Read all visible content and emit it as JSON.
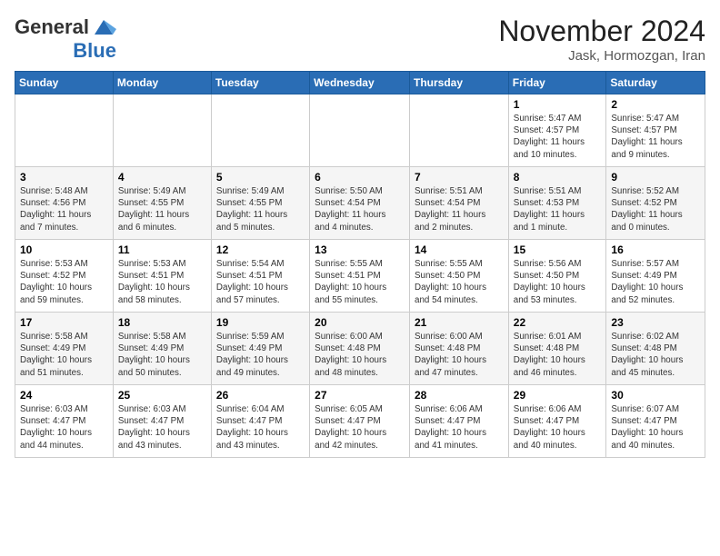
{
  "header": {
    "logo_line1": "General",
    "logo_line2": "Blue",
    "month_title": "November 2024",
    "subtitle": "Jask, Hormozgan, Iran"
  },
  "weekdays": [
    "Sunday",
    "Monday",
    "Tuesday",
    "Wednesday",
    "Thursday",
    "Friday",
    "Saturday"
  ],
  "weeks": [
    [
      {
        "day": "",
        "info": ""
      },
      {
        "day": "",
        "info": ""
      },
      {
        "day": "",
        "info": ""
      },
      {
        "day": "",
        "info": ""
      },
      {
        "day": "",
        "info": ""
      },
      {
        "day": "1",
        "info": "Sunrise: 5:47 AM\nSunset: 4:57 PM\nDaylight: 11 hours\nand 10 minutes."
      },
      {
        "day": "2",
        "info": "Sunrise: 5:47 AM\nSunset: 4:57 PM\nDaylight: 11 hours\nand 9 minutes."
      }
    ],
    [
      {
        "day": "3",
        "info": "Sunrise: 5:48 AM\nSunset: 4:56 PM\nDaylight: 11 hours\nand 7 minutes."
      },
      {
        "day": "4",
        "info": "Sunrise: 5:49 AM\nSunset: 4:55 PM\nDaylight: 11 hours\nand 6 minutes."
      },
      {
        "day": "5",
        "info": "Sunrise: 5:49 AM\nSunset: 4:55 PM\nDaylight: 11 hours\nand 5 minutes."
      },
      {
        "day": "6",
        "info": "Sunrise: 5:50 AM\nSunset: 4:54 PM\nDaylight: 11 hours\nand 4 minutes."
      },
      {
        "day": "7",
        "info": "Sunrise: 5:51 AM\nSunset: 4:54 PM\nDaylight: 11 hours\nand 2 minutes."
      },
      {
        "day": "8",
        "info": "Sunrise: 5:51 AM\nSunset: 4:53 PM\nDaylight: 11 hours\nand 1 minute."
      },
      {
        "day": "9",
        "info": "Sunrise: 5:52 AM\nSunset: 4:52 PM\nDaylight: 11 hours\nand 0 minutes."
      }
    ],
    [
      {
        "day": "10",
        "info": "Sunrise: 5:53 AM\nSunset: 4:52 PM\nDaylight: 10 hours\nand 59 minutes."
      },
      {
        "day": "11",
        "info": "Sunrise: 5:53 AM\nSunset: 4:51 PM\nDaylight: 10 hours\nand 58 minutes."
      },
      {
        "day": "12",
        "info": "Sunrise: 5:54 AM\nSunset: 4:51 PM\nDaylight: 10 hours\nand 57 minutes."
      },
      {
        "day": "13",
        "info": "Sunrise: 5:55 AM\nSunset: 4:51 PM\nDaylight: 10 hours\nand 55 minutes."
      },
      {
        "day": "14",
        "info": "Sunrise: 5:55 AM\nSunset: 4:50 PM\nDaylight: 10 hours\nand 54 minutes."
      },
      {
        "day": "15",
        "info": "Sunrise: 5:56 AM\nSunset: 4:50 PM\nDaylight: 10 hours\nand 53 minutes."
      },
      {
        "day": "16",
        "info": "Sunrise: 5:57 AM\nSunset: 4:49 PM\nDaylight: 10 hours\nand 52 minutes."
      }
    ],
    [
      {
        "day": "17",
        "info": "Sunrise: 5:58 AM\nSunset: 4:49 PM\nDaylight: 10 hours\nand 51 minutes."
      },
      {
        "day": "18",
        "info": "Sunrise: 5:58 AM\nSunset: 4:49 PM\nDaylight: 10 hours\nand 50 minutes."
      },
      {
        "day": "19",
        "info": "Sunrise: 5:59 AM\nSunset: 4:49 PM\nDaylight: 10 hours\nand 49 minutes."
      },
      {
        "day": "20",
        "info": "Sunrise: 6:00 AM\nSunset: 4:48 PM\nDaylight: 10 hours\nand 48 minutes."
      },
      {
        "day": "21",
        "info": "Sunrise: 6:00 AM\nSunset: 4:48 PM\nDaylight: 10 hours\nand 47 minutes."
      },
      {
        "day": "22",
        "info": "Sunrise: 6:01 AM\nSunset: 4:48 PM\nDaylight: 10 hours\nand 46 minutes."
      },
      {
        "day": "23",
        "info": "Sunrise: 6:02 AM\nSunset: 4:48 PM\nDaylight: 10 hours\nand 45 minutes."
      }
    ],
    [
      {
        "day": "24",
        "info": "Sunrise: 6:03 AM\nSunset: 4:47 PM\nDaylight: 10 hours\nand 44 minutes."
      },
      {
        "day": "25",
        "info": "Sunrise: 6:03 AM\nSunset: 4:47 PM\nDaylight: 10 hours\nand 43 minutes."
      },
      {
        "day": "26",
        "info": "Sunrise: 6:04 AM\nSunset: 4:47 PM\nDaylight: 10 hours\nand 43 minutes."
      },
      {
        "day": "27",
        "info": "Sunrise: 6:05 AM\nSunset: 4:47 PM\nDaylight: 10 hours\nand 42 minutes."
      },
      {
        "day": "28",
        "info": "Sunrise: 6:06 AM\nSunset: 4:47 PM\nDaylight: 10 hours\nand 41 minutes."
      },
      {
        "day": "29",
        "info": "Sunrise: 6:06 AM\nSunset: 4:47 PM\nDaylight: 10 hours\nand 40 minutes."
      },
      {
        "day": "30",
        "info": "Sunrise: 6:07 AM\nSunset: 4:47 PM\nDaylight: 10 hours\nand 40 minutes."
      }
    ]
  ]
}
